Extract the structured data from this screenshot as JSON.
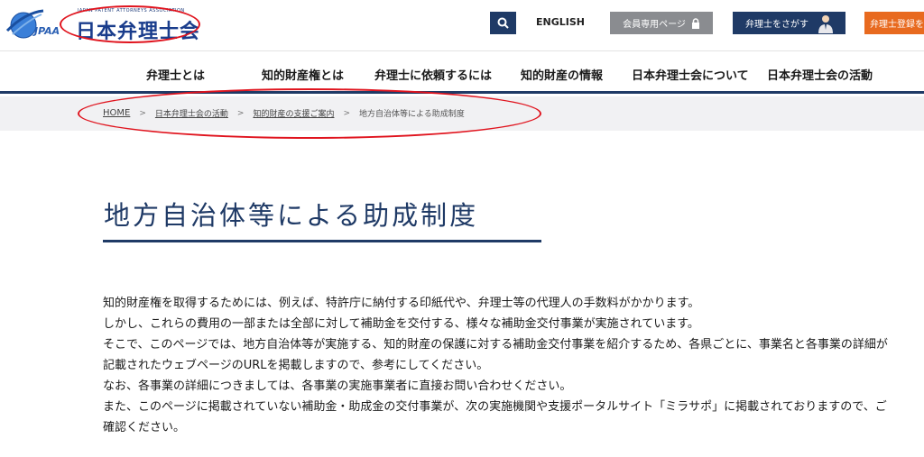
{
  "header": {
    "logo_small_text": "JAPAN PATENT ATTORNEYS ASSOCIATION",
    "logo_jpaa": "JPAA",
    "logo_main": "日本弁理士会",
    "english_label": "ENGLISH",
    "member_label": "会員専用ページ",
    "find_label": "弁理士をさがす",
    "register_label": "弁理士登録を"
  },
  "nav": {
    "items": [
      "弁理士とは",
      "知的財産権とは",
      "弁理士に依頼するには",
      "知的財産の情報",
      "日本弁理士会について",
      "日本弁理士会の活動"
    ]
  },
  "breadcrumb": {
    "home": "HOME",
    "level1": "日本弁理士会の活動",
    "level2": "知的財産の支援ご案内",
    "current": "地方自治体等による助成制度",
    "separator": ">"
  },
  "page": {
    "title": "地方自治体等による助成制度",
    "paragraphs": [
      "知的財産権を取得するためには、例えば、特許庁に納付する印紙代や、弁理士等の代理人の手数料がかかります。",
      "しかし、これらの費用の一部または全部に対して補助金を交付する、様々な補助金交付事業が実施されています。",
      "そこで、このページでは、地方自治体等が実施する、知的財産の保護に対する補助金交付事業を紹介するため、各県ごとに、事業名と各事業の詳細が記載されたウェブページのURLを掲載しますので、参考にしてください。",
      "なお、各事業の詳細につきましては、各事業の実施事業者に直接お問い合わせください。",
      "また、このページに掲載されていない補助金・助成金の交付事業が、次の実施機関や支援ポータルサイト「ミラサポ」に掲載されておりますので、ご確認ください。"
    ]
  },
  "colors": {
    "navy": "#1f3a66",
    "accent_orange": "#e86a1f",
    "member_gray": "#8a8c90",
    "annotation_red": "#e0141e"
  }
}
